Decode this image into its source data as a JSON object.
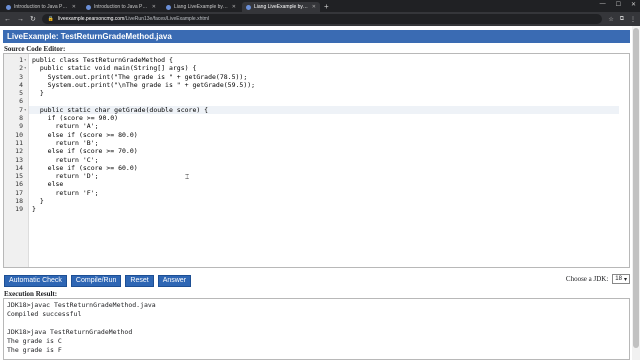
{
  "tabs": [
    {
      "title": "Introduction to Java Programm",
      "active": false
    },
    {
      "title": "Introduction to Java Programm",
      "active": false
    },
    {
      "title": "Liang LiveExample by Y. Daniel L",
      "active": false
    },
    {
      "title": "Liang LiveExample by Y. Daniel L",
      "active": true
    }
  ],
  "address": {
    "host": "liveexample.pearsoncmg.com",
    "path": "/LiveRun13e/faces/LiveExample.xhtml"
  },
  "header": {
    "title": "LiveExample: TestReturnGradeMethod.java"
  },
  "editor": {
    "label": "Source Code Editor:",
    "lines": [
      {
        "n": "1",
        "fold": true,
        "code": "public class TestReturnGradeMethod {"
      },
      {
        "n": "2",
        "fold": true,
        "code": "  public static void main(String[] args) {"
      },
      {
        "n": "3",
        "fold": false,
        "code": "    System.out.print(\"The grade is \" + getGrade(78.5));"
      },
      {
        "n": "4",
        "fold": false,
        "code": "    System.out.print(\"\\nThe grade is \" + getGrade(59.5));"
      },
      {
        "n": "5",
        "fold": false,
        "code": "  }"
      },
      {
        "n": "6",
        "fold": false,
        "code": ""
      },
      {
        "n": "7",
        "fold": true,
        "code": "  public static char getGrade(double score) {"
      },
      {
        "n": "8",
        "fold": false,
        "code": "    if (score >= 90.0)"
      },
      {
        "n": "9",
        "fold": false,
        "code": "      return 'A';"
      },
      {
        "n": "10",
        "fold": false,
        "code": "    else if (score >= 80.0)"
      },
      {
        "n": "11",
        "fold": false,
        "code": "      return 'B';"
      },
      {
        "n": "12",
        "fold": false,
        "code": "    else if (score >= 70.0)"
      },
      {
        "n": "13",
        "fold": false,
        "code": "      return 'C';"
      },
      {
        "n": "14",
        "fold": false,
        "code": "    else if (score >= 60.0)"
      },
      {
        "n": "15",
        "fold": false,
        "code": "      return 'D';"
      },
      {
        "n": "16",
        "fold": false,
        "code": "    else"
      },
      {
        "n": "17",
        "fold": false,
        "code": "      return 'F';"
      },
      {
        "n": "18",
        "fold": false,
        "code": "  }"
      },
      {
        "n": "19",
        "fold": false,
        "code": "}"
      }
    ]
  },
  "buttons": {
    "check": "Automatic Check",
    "compile": "Compile/Run",
    "reset": "Reset",
    "answer": "Answer"
  },
  "jdk": {
    "label": "Choose a JDK:",
    "value": "18"
  },
  "result": {
    "label": "Execution Result:",
    "lines": [
      "JDK18>javac TestReturnGradeMethod.java",
      "Compiled successful",
      "",
      "JDK18>java TestReturnGradeMethod",
      "The grade is C",
      "The grade is F"
    ]
  }
}
